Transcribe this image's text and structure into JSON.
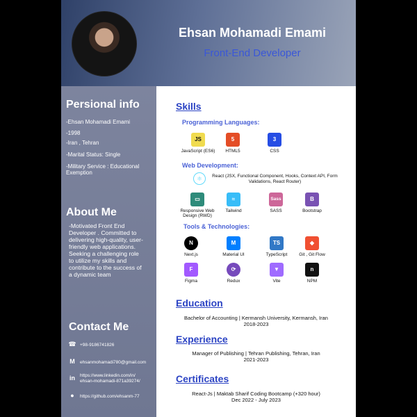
{
  "header": {
    "name": "Ehsan Mohamadi Emami",
    "role": "Front-End Developer"
  },
  "sidebar": {
    "personal_title": "Persional info",
    "personal": [
      "-Ehsan Mohamadi Emami",
      "-1998",
      "-Iran , Tehran",
      "-Marital Status: Single",
      "-Military Service : Educational Exemption"
    ],
    "about_title": "About Me",
    "about_text": "-Motivated Front End Developer . Committed to delivering high-quality, user-friendly web applications. Seeking a challenging role to utilize my skills and contribute to the success of a dynamic team",
    "contact_title": "Contact Me",
    "contacts": [
      {
        "icon": "phone-icon",
        "text": "+98-9186741826"
      },
      {
        "icon": "mail-icon",
        "text": "ehsanmohamadi780@gmail.com"
      },
      {
        "icon": "linkedin-icon",
        "text": "https://www.linkedin.com/in/ ehsan-mohamadi-871a39274/"
      },
      {
        "icon": "github-icon",
        "text": "https://github.com/ehsanm-77"
      }
    ]
  },
  "skills": {
    "title": "Skills",
    "programming_title": "Programming Languages:",
    "programming": [
      {
        "label": "JavaScript (ES6)",
        "icon": "js-icon",
        "logo": "JS",
        "color": "#f0db4f"
      },
      {
        "label": "HTML5",
        "icon": "html5-icon",
        "logo": "5",
        "color": "#e44d26"
      },
      {
        "label": "CSS",
        "icon": "css3-icon",
        "logo": "3",
        "color": "#264de4"
      }
    ],
    "web_title": "Web Development:",
    "react_text": "React (JSX, Functional Component, Hooks, Context API, Form Validations, React Router)",
    "web": [
      {
        "label": "Responsive Web Design (RWD)",
        "icon": "responsive-devices-icon",
        "logo": "▭",
        "color": "#2e8b7a"
      },
      {
        "label": "Tailwind",
        "icon": "tailwind-icon",
        "logo": "≈",
        "color": "#38bdf8"
      },
      {
        "label": "SASS",
        "icon": "sass-icon",
        "logo": "Sass",
        "color": "#cd6799"
      },
      {
        "label": "Bootstrap",
        "icon": "bootstrap-icon",
        "logo": "B",
        "color": "#7952b3"
      }
    ],
    "tools_title": "Tools & Technologies:",
    "tools": [
      {
        "label": "Next.js",
        "icon": "nextjs-icon",
        "logo": "N",
        "color": "#000000"
      },
      {
        "label": "Material UI",
        "icon": "material-ui-icon",
        "logo": "M",
        "color": "#007fff"
      },
      {
        "label": "TypeScript",
        "icon": "typescript-icon",
        "logo": "TS",
        "color": "#3178c6"
      },
      {
        "label": "Git , Git Flow",
        "icon": "git-icon",
        "logo": "◆",
        "color": "#f05032"
      },
      {
        "label": "Figma",
        "icon": "figma-icon",
        "logo": "F",
        "color": "#a259ff"
      },
      {
        "label": "Redux",
        "icon": "redux-icon",
        "logo": "⟳",
        "color": "#764abc"
      },
      {
        "label": "Vite",
        "icon": "vite-icon",
        "logo": "▼",
        "color": "#9f6bff"
      },
      {
        "label": "NPM",
        "icon": "npm-icon",
        "logo": "n",
        "color": "#111111"
      }
    ]
  },
  "education": {
    "title": "Education",
    "line1": "Bachelor of Accounting | Kermansh University, Kermansh, Iran",
    "line2": "2018-2023"
  },
  "experience": {
    "title": "Experience",
    "line1": "Manager of Publishing | Tehran Publishing, Tehran, Iran",
    "line2": "2021-2023"
  },
  "certificates": {
    "title": "Certificates",
    "line1": "React-Js | Maktab Sharif Coding Bootcamp (+320 hour)",
    "line2": "Dec 2022 - July 2023"
  }
}
